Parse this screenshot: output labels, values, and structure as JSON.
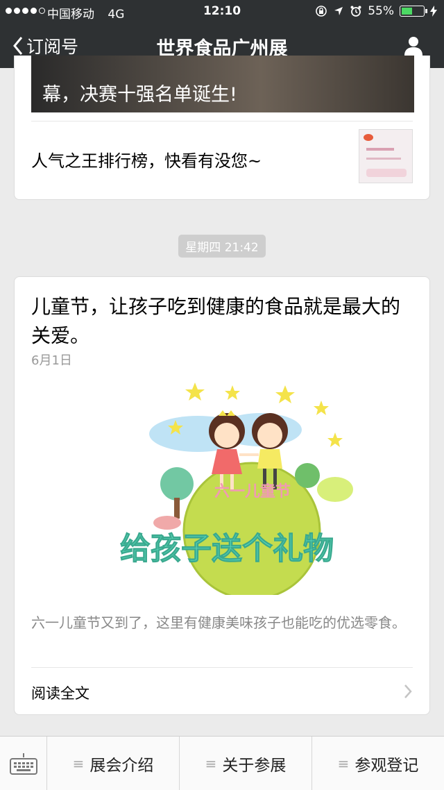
{
  "status": {
    "carrier": "中国移动",
    "network": "4G",
    "time": "12:10",
    "battery": "55%",
    "battery_level": 0.55
  },
  "nav": {
    "back_label": "订阅号",
    "title": "世界食品广州展"
  },
  "card1": {
    "cover_text": "幕，决赛十强名单诞生!",
    "item_title": "人气之王排行榜，快看有没您~"
  },
  "timestamp": "星期四 21:42",
  "card2": {
    "title": "儿童节，让孩子吃到健康的食品就是最大的关爱。",
    "date": "6月1日",
    "cover_text_small": "六一儿童节",
    "cover_text_big": "给孩子送个礼物",
    "description": "六一儿童节又到了，这里有健康美味孩子也能吃的优选零食。",
    "read_more": "阅读全文"
  },
  "menu": {
    "items": [
      {
        "label": "展会介绍"
      },
      {
        "label": "关于参展"
      },
      {
        "label": "参观登记"
      }
    ]
  },
  "colors": {
    "nav_bg": "#2e3133",
    "battery_green": "#4cd964",
    "page_bg": "#ebebeb"
  }
}
